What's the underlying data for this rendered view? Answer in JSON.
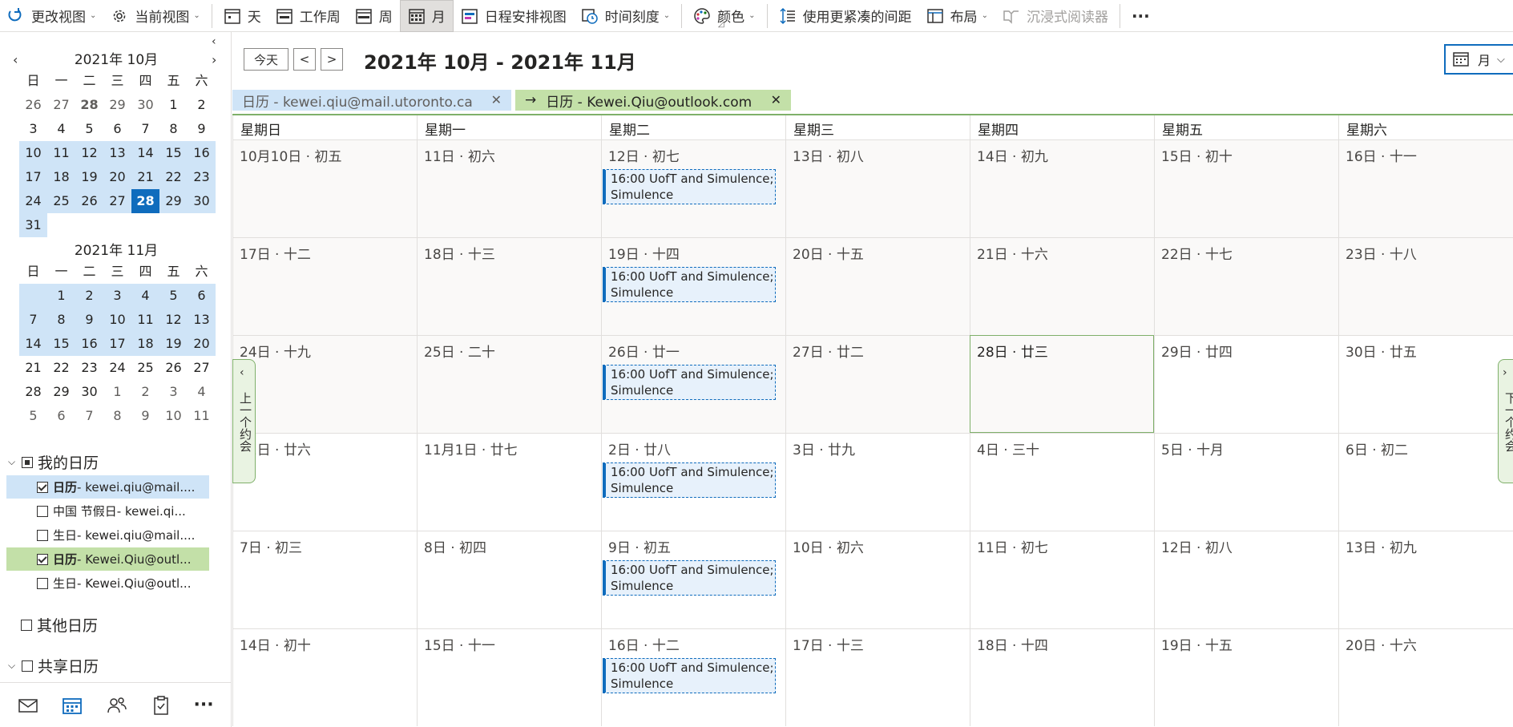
{
  "ribbon": {
    "change_view": "更改视图",
    "current_view": "当前视图",
    "day": "天",
    "work_week": "工作周",
    "week": "周",
    "month": "月",
    "schedule_view": "日程安排视图",
    "time_scale": "时间刻度",
    "color": "颜色",
    "compact": "使用更紧凑的间距",
    "layout": "布局",
    "immersive": "沉浸式阅读器",
    "more": "···"
  },
  "minical": {
    "weekdays": [
      "日",
      "一",
      "二",
      "三",
      "四",
      "五",
      "六"
    ],
    "oct": {
      "title": "2021年 10月",
      "days": [
        "26",
        "27",
        "28",
        "29",
        "30",
        "1",
        "2",
        "3",
        "4",
        "5",
        "6",
        "7",
        "8",
        "9",
        "10",
        "11",
        "12",
        "13",
        "14",
        "15",
        "16",
        "17",
        "18",
        "19",
        "20",
        "21",
        "22",
        "23",
        "24",
        "25",
        "26",
        "27",
        "28",
        "29",
        "30",
        "31"
      ]
    },
    "nov": {
      "title": "2021年 11月",
      "days": [
        "1",
        "2",
        "3",
        "4",
        "5",
        "6",
        "7",
        "8",
        "9",
        "10",
        "11",
        "12",
        "13",
        "14",
        "15",
        "16",
        "17",
        "18",
        "19",
        "20",
        "21",
        "22",
        "23",
        "24",
        "25",
        "26",
        "27",
        "28",
        "29",
        "30",
        "1",
        "2",
        "3",
        "4",
        "5",
        "6",
        "7",
        "8",
        "9",
        "10",
        "11"
      ]
    }
  },
  "calendars": {
    "my_cal": "我的日历",
    "items": [
      {
        "name": "日历",
        "acct": " - kewei.qiu@mail...."
      },
      {
        "name": "中国 节假日",
        "acct": " - kewei.qi..."
      },
      {
        "name": "生日",
        "acct": " - kewei.qiu@mail...."
      },
      {
        "name": "日历",
        "acct": " - Kewei.Qiu@outl..."
      },
      {
        "name": "生日",
        "acct": " - Kewei.Qiu@outl..."
      }
    ],
    "other": "其他日历",
    "shared": "共享日历"
  },
  "main": {
    "today": "今天",
    "prev": "<",
    "next": ">",
    "title": "2021年 10月 - 2021年 11月",
    "view_label": "月",
    "tab1": "日历 - kewei.qiu@mail.utoronto.ca",
    "tab2_arrow": "→",
    "tab2": "日历 - Kewei.Qiu@outlook.com",
    "close": "✕",
    "prev_appt": "上一个约会",
    "next_appt": "下一个约会",
    "weekdays": [
      "星期日",
      "星期一",
      "星期二",
      "星期三",
      "星期四",
      "星期五",
      "星期六"
    ],
    "weeks": [
      [
        "10月10日 · 初五",
        "11日 · 初六",
        "12日 · 初七",
        "13日 · 初八",
        "14日 · 初九",
        "15日 · 初十",
        "16日 · 十一"
      ],
      [
        "17日 · 十二",
        "18日 · 十三",
        "19日 · 十四",
        "20日 · 十五",
        "21日 · 十六",
        "22日 · 十七",
        "23日 · 十八"
      ],
      [
        "24日 · 十九",
        "25日 · 二十",
        "26日 · 廿一",
        "27日 · 廿二",
        "28日 · 廿三",
        "29日 · 廿四",
        "30日 · 廿五"
      ],
      [
        "31日 · 廿六",
        "11月1日 · 廿七",
        "2日 · 廿八",
        "3日 · 廿九",
        "4日 · 三十",
        "5日 · 十月",
        "6日 · 初二"
      ],
      [
        "7日 · 初三",
        "8日 · 初四",
        "9日 · 初五",
        "10日 · 初六",
        "11日 · 初七",
        "12日 · 初八",
        "13日 · 初九"
      ],
      [
        "14日 · 初十",
        "15日 · 十一",
        "16日 · 十二",
        "17日 · 十三",
        "18日 · 十四",
        "19日 · 十五",
        "20日 · 十六"
      ]
    ],
    "event": "16:00 UofT and Simulence; Simulence"
  },
  "colors": {
    "accent": "#0f6cbd",
    "cal1_bg": "#cfe4f7",
    "cal2_bg": "#c3e0a8",
    "green_border": "#7fb06a"
  }
}
